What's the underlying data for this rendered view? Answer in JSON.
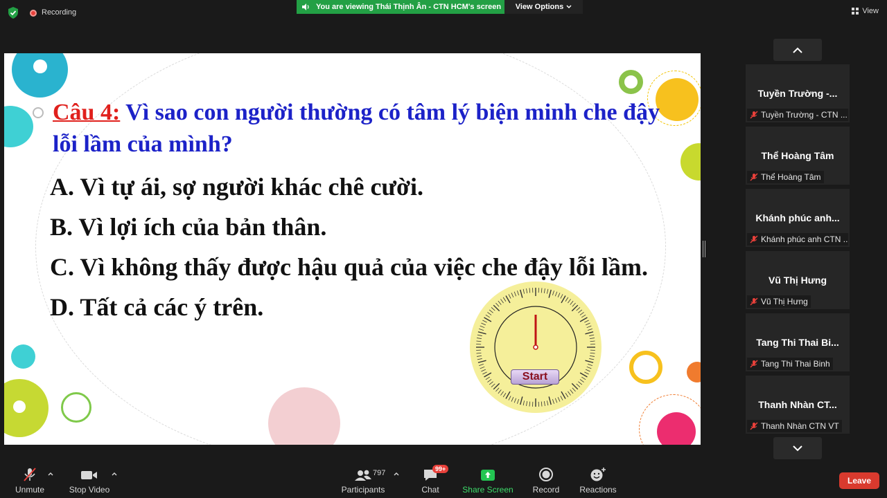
{
  "top_bar": {
    "recording_label": "Recording",
    "viewing_banner": "You are viewing Thái Thịnh Ân - CTN HCM's screen",
    "view_options_label": "View Options",
    "view_label": "View"
  },
  "slide": {
    "question_number": "Câu 4:",
    "question_text": " Vì sao con người thường có tâm lý biện minh che đậy lỗi lầm của mình?",
    "answers": [
      "A. Vì tự ái, sợ người khác chê cười.",
      "B. Vì lợi ích của bản thân.",
      "C. Vì không thấy được hậu quả của việc che đậy lỗi lầm.",
      "D. Tất cả các ý trên."
    ],
    "timer_button": "Start",
    "colors": {
      "question_number": "#e0201c",
      "question_text": "#1c22c8",
      "timer_face": "#f5ef9a"
    }
  },
  "participants_panel": {
    "tiles": [
      {
        "display_name": "Tuyền Trường -...",
        "label": "Tuyền Trường - CTN ..."
      },
      {
        "display_name": "Thể Hoàng Tâm",
        "label": "Thể Hoàng Tâm"
      },
      {
        "display_name": "Khánh phúc anh...",
        "label": "Khánh phúc anh CTN ..."
      },
      {
        "display_name": "Vũ Thị Hưng",
        "label": "Vũ Thị Hưng"
      },
      {
        "display_name": "Tang Thi Thai Bi...",
        "label": "Tang Thi Thai Binh"
      },
      {
        "display_name": "Thanh Nhàn CT...",
        "label": "Thanh Nhàn CTN VT"
      }
    ]
  },
  "toolbar": {
    "unmute": "Unmute",
    "stop_video": "Stop Video",
    "participants": "Participants",
    "participants_count": "797",
    "chat": "Chat",
    "chat_badge": "99+",
    "share_screen": "Share Screen",
    "record": "Record",
    "reactions": "Reactions",
    "leave": "Leave"
  }
}
